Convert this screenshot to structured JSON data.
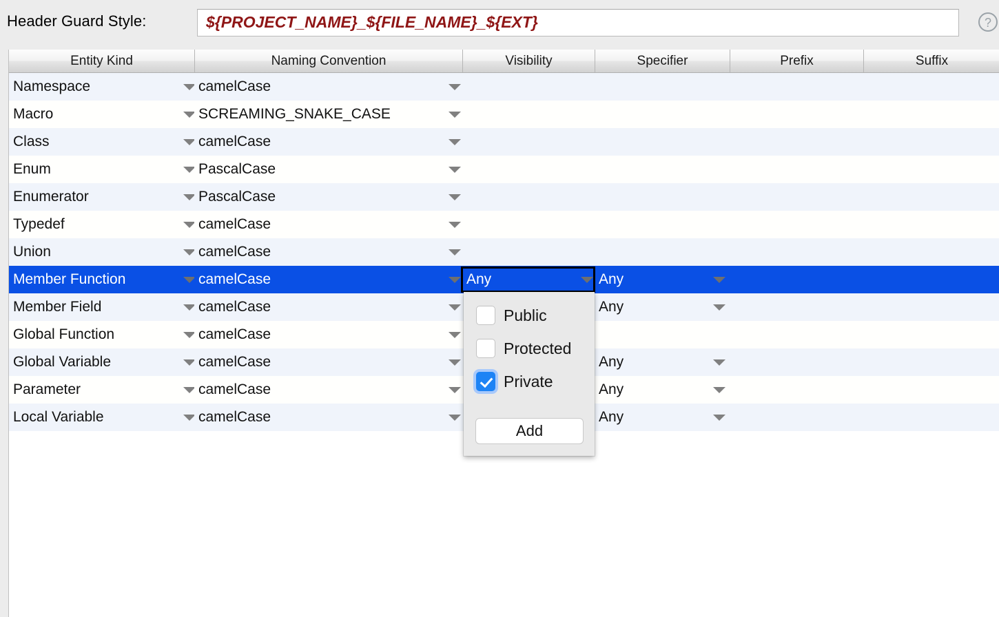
{
  "header": {
    "label": "Header Guard Style:",
    "value": "${PROJECT_NAME}_${FILE_NAME}_${EXT}",
    "placeholder": "${PROJECT_NAME}_${FILE_NAME}_${EXT}",
    "help_icon": "question-mark-icon",
    "value_color": "#8f1616"
  },
  "table": {
    "columns": [
      {
        "label": "Entity Kind"
      },
      {
        "label": "Naming Convention"
      },
      {
        "label": "Visibility"
      },
      {
        "label": "Specifier"
      },
      {
        "label": "Prefix"
      },
      {
        "label": "Suffix"
      }
    ],
    "rows": [
      {
        "entity_kind": "Namespace",
        "naming_convention": "camelCase",
        "visibility": "",
        "specifier": "",
        "prefix": "",
        "suffix": "",
        "selected": false
      },
      {
        "entity_kind": "Macro",
        "naming_convention": "SCREAMING_SNAKE_CASE",
        "visibility": "",
        "specifier": "",
        "prefix": "",
        "suffix": "",
        "selected": false
      },
      {
        "entity_kind": "Class",
        "naming_convention": "camelCase",
        "visibility": "",
        "specifier": "",
        "prefix": "",
        "suffix": "",
        "selected": false
      },
      {
        "entity_kind": "Enum",
        "naming_convention": "PascalCase",
        "visibility": "",
        "specifier": "",
        "prefix": "",
        "suffix": "",
        "selected": false
      },
      {
        "entity_kind": "Enumerator",
        "naming_convention": "PascalCase",
        "visibility": "",
        "specifier": "",
        "prefix": "",
        "suffix": "",
        "selected": false
      },
      {
        "entity_kind": "Typedef",
        "naming_convention": "camelCase",
        "visibility": "",
        "specifier": "",
        "prefix": "",
        "suffix": "",
        "selected": false
      },
      {
        "entity_kind": "Union",
        "naming_convention": "camelCase",
        "visibility": "",
        "specifier": "",
        "prefix": "",
        "suffix": "",
        "selected": false
      },
      {
        "entity_kind": "Member Function",
        "naming_convention": "camelCase",
        "visibility": "Any",
        "specifier": "Any",
        "prefix": "",
        "suffix": "",
        "selected": true
      },
      {
        "entity_kind": "Member Field",
        "naming_convention": "camelCase",
        "visibility": "",
        "specifier": "Any",
        "prefix": "",
        "suffix": "",
        "selected": false
      },
      {
        "entity_kind": "Global Function",
        "naming_convention": "camelCase",
        "visibility": "",
        "specifier": "",
        "prefix": "",
        "suffix": "",
        "selected": false
      },
      {
        "entity_kind": "Global Variable",
        "naming_convention": "camelCase",
        "visibility": "",
        "specifier": "Any",
        "prefix": "",
        "suffix": "",
        "selected": false
      },
      {
        "entity_kind": "Parameter",
        "naming_convention": "camelCase",
        "visibility": "",
        "specifier": "Any",
        "prefix": "",
        "suffix": "",
        "selected": false
      },
      {
        "entity_kind": "Local Variable",
        "naming_convention": "camelCase",
        "visibility": "",
        "specifier": "Any",
        "prefix": "",
        "suffix": "",
        "selected": false
      }
    ],
    "selected_row_color": "#0a50e5",
    "alt_row_color": "#f0f4fb"
  },
  "visibility_popup": {
    "options": [
      {
        "label": "Public",
        "checked": false
      },
      {
        "label": "Protected",
        "checked": false
      },
      {
        "label": "Private",
        "checked": true
      }
    ],
    "add_label": "Add",
    "accent_color": "#1d83f5"
  }
}
